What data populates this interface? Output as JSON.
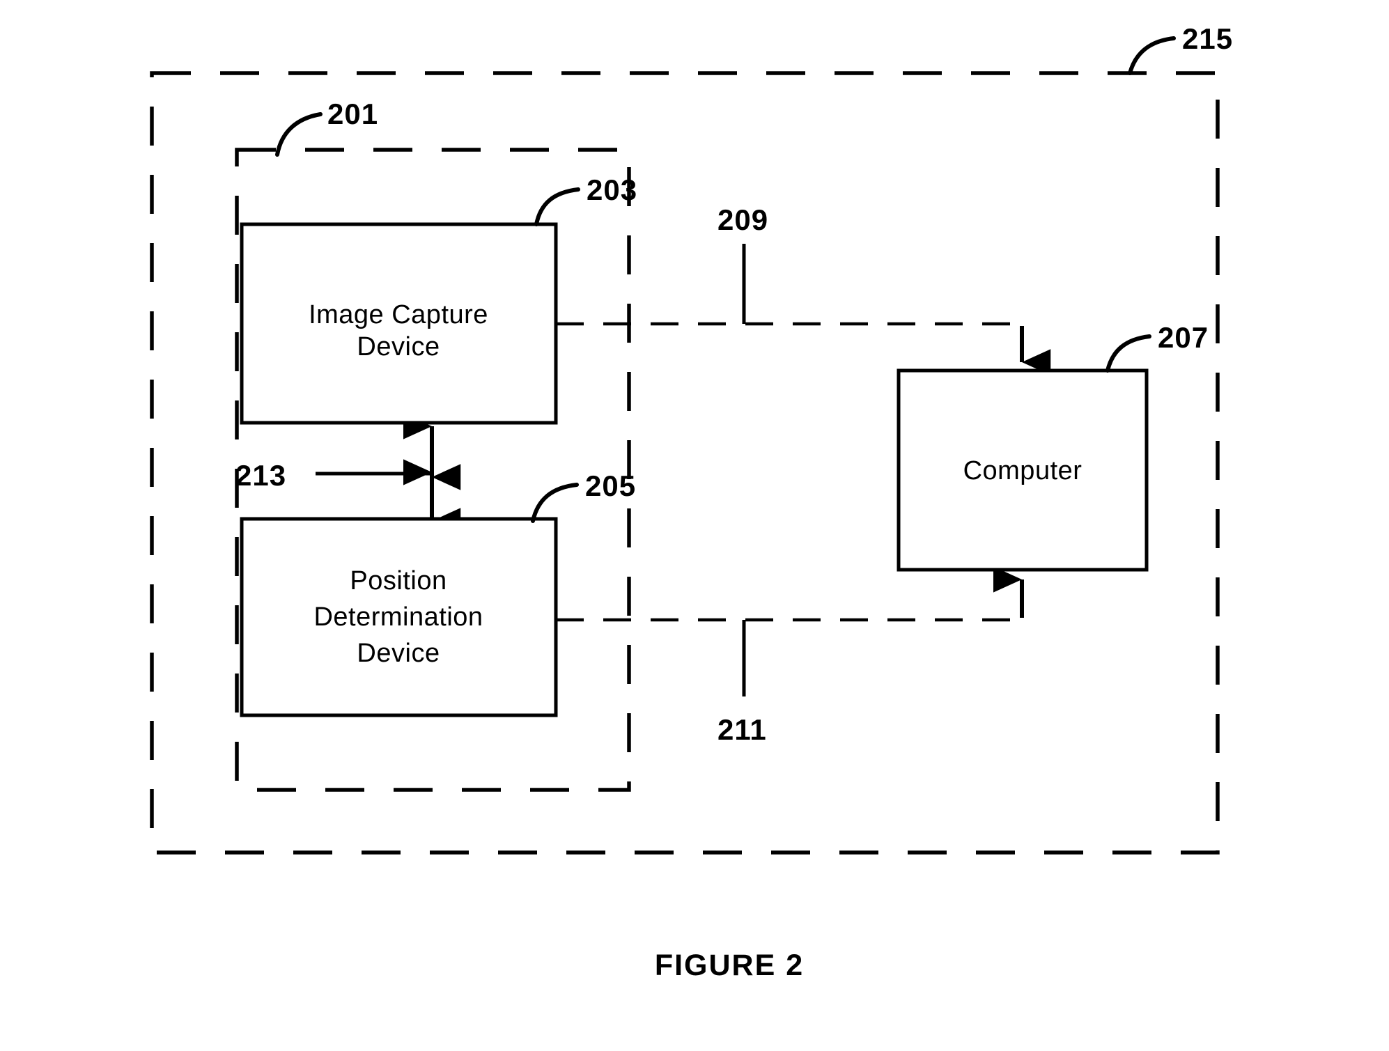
{
  "figure": {
    "caption": "FIGURE 2"
  },
  "regions": {
    "system": {
      "ref": "215",
      "name": "system-boundary",
      "style": "dashed"
    },
    "capture_unit": {
      "ref": "201",
      "name": "capture-unit-boundary",
      "style": "dashed"
    }
  },
  "blocks": [
    {
      "ref": "203",
      "name": "image-capture-device",
      "lines": [
        "Image Capture",
        "Device"
      ],
      "label": "Image Capture Device"
    },
    {
      "ref": "205",
      "name": "position-determination-device",
      "lines": [
        "Position",
        "Determination",
        "Device"
      ],
      "label": "Position Determination Device"
    },
    {
      "ref": "207",
      "name": "computer",
      "lines": [
        "Computer"
      ],
      "label": "Computer"
    }
  ],
  "connections": [
    {
      "ref": "209",
      "name": "image-data-link",
      "from": "203",
      "to": "207",
      "style": "dashed",
      "arrow": "down-into-computer"
    },
    {
      "ref": "211",
      "name": "position-data-link",
      "from": "205",
      "to": "207",
      "style": "dashed",
      "arrow": "up-into-computer"
    },
    {
      "ref": "213",
      "name": "device-interconnect",
      "from": "203",
      "to": "205",
      "style": "solid",
      "arrow": "double-headed"
    }
  ],
  "colors": {
    "stroke": "#000000",
    "background": "#ffffff"
  }
}
